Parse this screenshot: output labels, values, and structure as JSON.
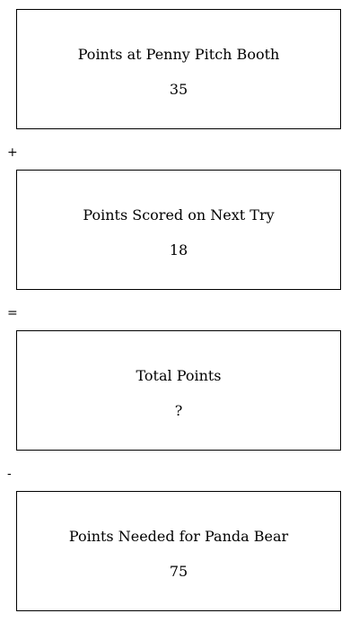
{
  "boxes": [
    {
      "label": "Points at Penny Pitch Booth",
      "value": "35"
    },
    {
      "label": "Points Scored on Next Try",
      "value": "18"
    },
    {
      "label": "Total Points",
      "value": "?"
    },
    {
      "label": "Points Needed for Panda Bear",
      "value": "75"
    }
  ],
  "operators": [
    "+",
    "=",
    "-"
  ]
}
